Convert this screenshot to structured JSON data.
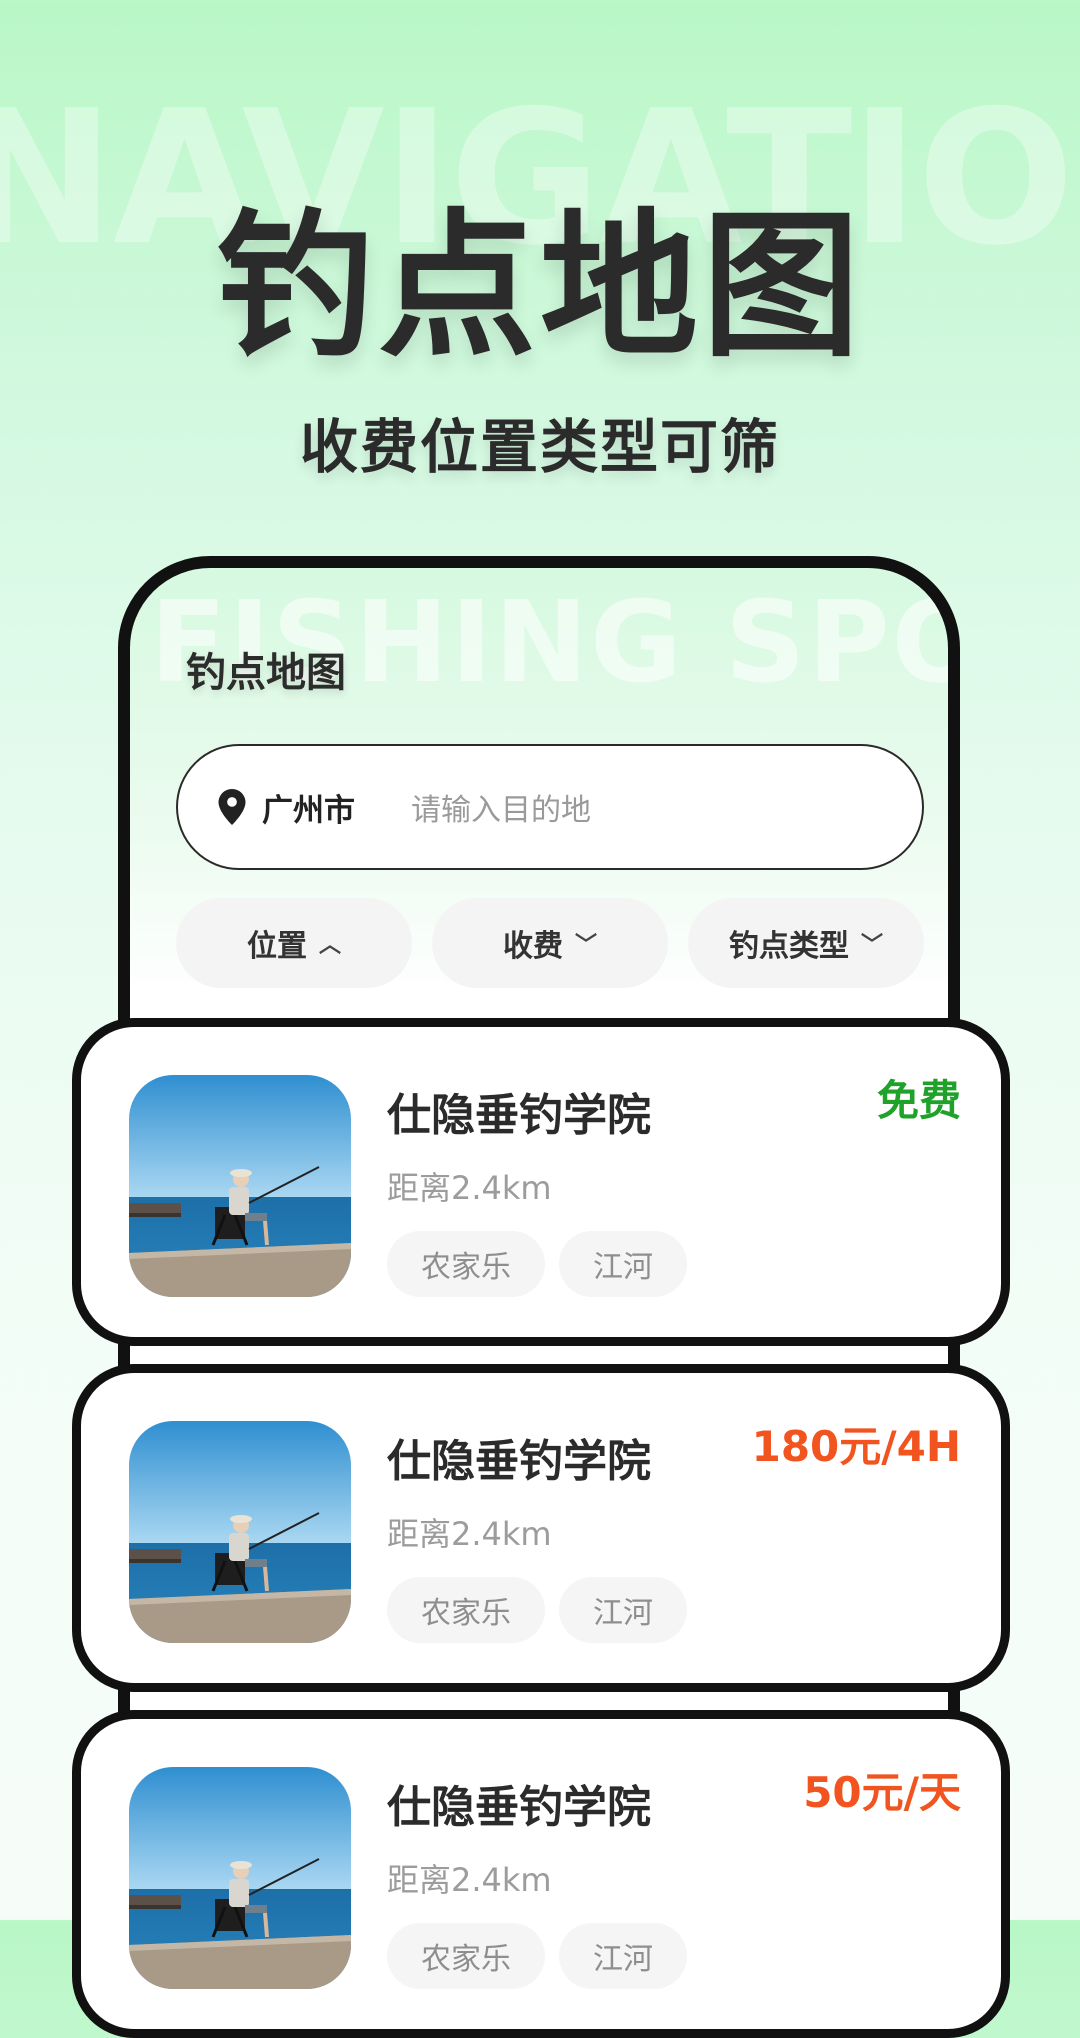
{
  "background": {
    "watermark": "NAVIGATION"
  },
  "hero": {
    "title": "钓点地图",
    "subtitle": "收费位置类型可筛"
  },
  "phone": {
    "watermark": "FISHING SPOT",
    "title": "钓点地图",
    "search": {
      "city": "广州市",
      "placeholder": "请输入目的地",
      "icon": "location-pin-icon"
    },
    "filters": [
      {
        "label": "位置",
        "chevron": "up"
      },
      {
        "label": "收费",
        "chevron": "down"
      },
      {
        "label": "钓点类型",
        "chevron": "down"
      }
    ]
  },
  "spots": [
    {
      "name": "仕隐垂钓学院",
      "price": "免费",
      "price_color": "#1fa12a",
      "distance": "距离2.4km",
      "tags": [
        "农家乐",
        "江河"
      ]
    },
    {
      "name": "仕隐垂钓学院",
      "price": "180元/4H",
      "price_color": "#f2541f",
      "distance": "距离2.4km",
      "tags": [
        "农家乐",
        "江河"
      ]
    },
    {
      "name": "仕隐垂钓学院",
      "price": "50元/天",
      "price_color": "#f2541f",
      "distance": "距离2.4km",
      "tags": [
        "农家乐",
        "江河"
      ]
    }
  ]
}
